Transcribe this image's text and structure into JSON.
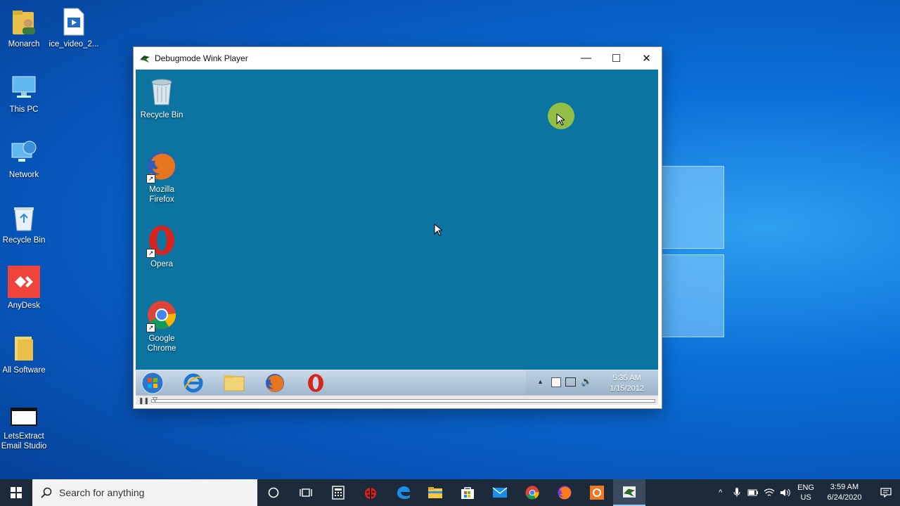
{
  "desktop": {
    "icons": [
      {
        "label": "Monarch"
      },
      {
        "label": "ice_video_2..."
      },
      {
        "label": "This PC"
      },
      {
        "label": "Network"
      },
      {
        "label": "Recycle Bin"
      },
      {
        "label": "AnyDesk"
      },
      {
        "label": "All Software"
      },
      {
        "label": "LetsExtract Email Studio"
      }
    ]
  },
  "window": {
    "title": "Debugmode Wink Player",
    "controls": {
      "minimize": "—",
      "maximize": "☐",
      "close": "✕"
    },
    "inner_desktop": {
      "icons": [
        {
          "label": "Recycle Bin"
        },
        {
          "label": "Mozilla Firefox"
        },
        {
          "label": "Opera"
        },
        {
          "label": "Google Chrome"
        }
      ],
      "clock": {
        "time": "5:35 AM",
        "date": "1/15/2012"
      }
    }
  },
  "taskbar": {
    "search_placeholder": "Search for anything",
    "language": {
      "line1": "ENG",
      "line2": "US"
    },
    "clock": {
      "time": "3:59 AM",
      "date": "6/24/2020"
    }
  },
  "colors": {
    "inner_desktop": "#0b74a0",
    "taskbar": "#1c2a3a",
    "cursor_highlight": "#a0c83c"
  }
}
